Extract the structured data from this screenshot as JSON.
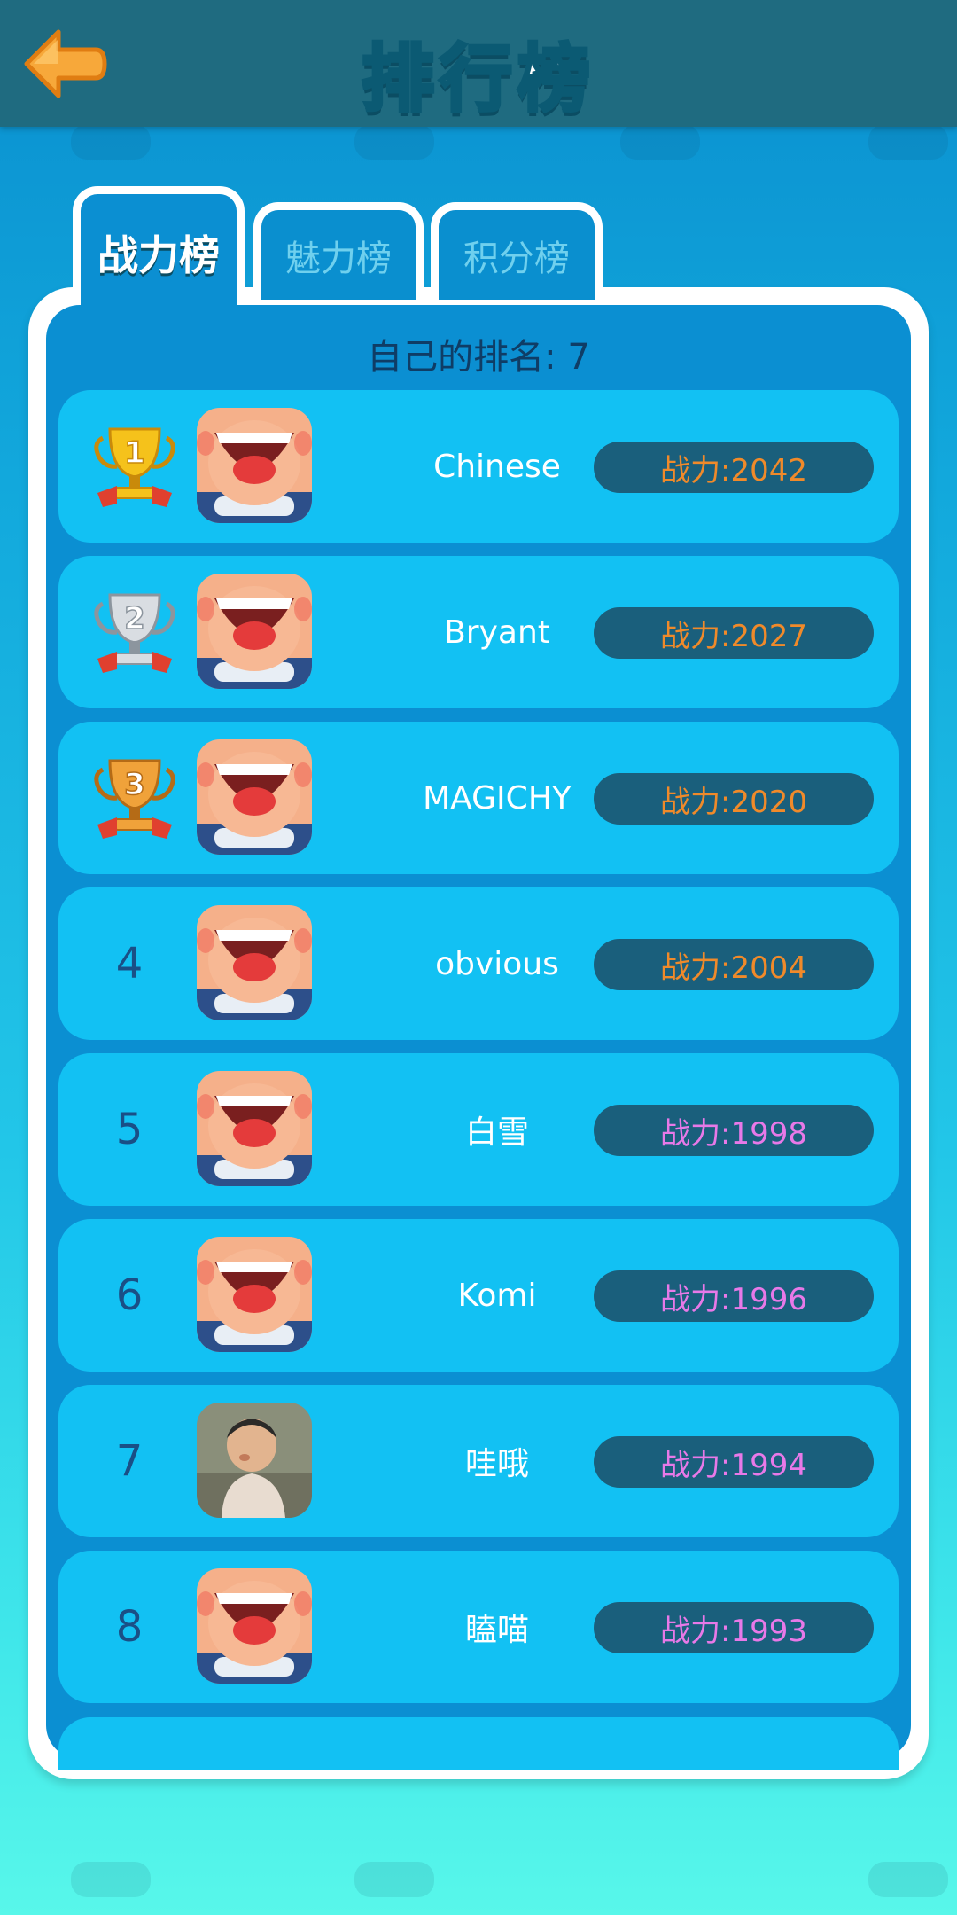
{
  "header": {
    "title": "排行榜",
    "back_icon": "back-arrow-icon"
  },
  "tabs": [
    {
      "label": "战力榜",
      "active": true
    },
    {
      "label": "魅力榜",
      "active": false
    },
    {
      "label": "积分榜",
      "active": false
    }
  ],
  "my_rank_text": "自己的排名: 7",
  "rows": [
    {
      "rank": "1",
      "name": "Chinese",
      "power": "战力:2042",
      "medal": "gold-trophy-icon",
      "power_color": "#f08a2a"
    },
    {
      "rank": "2",
      "name": "Bryant",
      "power": "战力:2027",
      "medal": "silver-trophy-icon",
      "power_color": "#f08a2a"
    },
    {
      "rank": "3",
      "name": "MAGICHY",
      "power": "战力:2020",
      "medal": "bronze-trophy-icon",
      "power_color": "#f08a2a"
    },
    {
      "rank": "4",
      "name": "obvious",
      "power": "战力:2004",
      "power_color": "#f08a2a"
    },
    {
      "rank": "5",
      "name": "白雪",
      "power": "战力:1998",
      "power_color": "#e879e8"
    },
    {
      "rank": "6",
      "name": "Komi",
      "power": "战力:1996",
      "power_color": "#e879e8"
    },
    {
      "rank": "7",
      "name": "哇哦",
      "power": "战力:1994",
      "power_color": "#e879e8"
    },
    {
      "rank": "8",
      "name": "瞌喵",
      "power": "战力:1993",
      "power_color": "#e879e8"
    }
  ],
  "colors": {
    "topbar": "#1f6b80",
    "panel": "#0b8fd2",
    "row": "#12c1f3",
    "pill": "#1a5f7c"
  }
}
